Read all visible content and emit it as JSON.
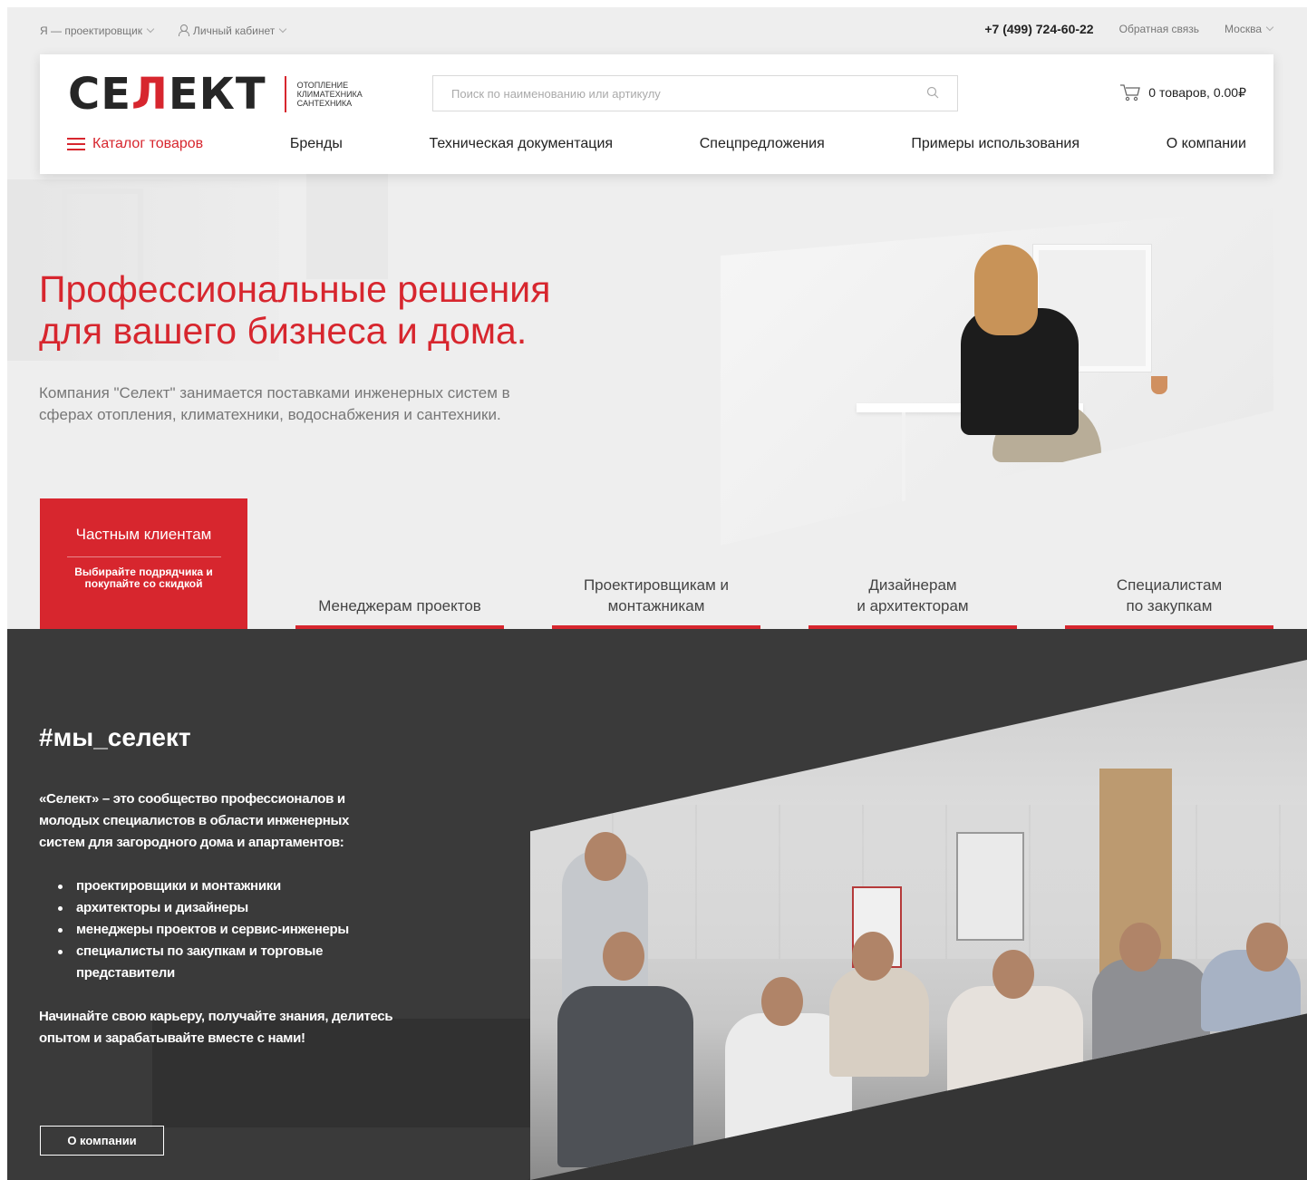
{
  "topbar": {
    "role_selector": "Я — проектировщик",
    "account": "Личный кабинет",
    "phone": "+7 (499) 724-60-22",
    "feedback": "Обратная связь",
    "city": "Москва"
  },
  "header": {
    "logo": {
      "word": "СЕЛЕКТ",
      "tagline": [
        "ОТОПЛЕНИЕ",
        "КЛИМАТЕХНИКА",
        "САНТЕХНИКА"
      ]
    },
    "search": {
      "placeholder": "Поиск по наименованию или артикулу",
      "value": ""
    },
    "cart": {
      "label": "0 товаров, 0.00₽"
    },
    "nav": [
      "Каталог товаров",
      "Бренды",
      "Техническая документация",
      "Спецпредложения",
      "Примеры использования",
      "О компании"
    ]
  },
  "hero": {
    "title_line1": "Профессиональные решения",
    "title_line2": "для вашего бизнеса и дома.",
    "description": "Компания \"Селект\" занимается поставками инженерных систем в сферах отопления, климатехники, водоснабжения и сантехники."
  },
  "audience_tabs": {
    "active": {
      "label": "Частным клиентам",
      "sublabel": "Выбирайте подрядчика и покупайте со скидкой"
    },
    "items": [
      {
        "line1": "Менеджерам проектов",
        "line2": ""
      },
      {
        "line1": "Проектировщикам и",
        "line2": "монтажникам"
      },
      {
        "line1": "Дизайнерам",
        "line2": "и архитекторам"
      },
      {
        "line1": "Специалистам",
        "line2": "по закупкам"
      }
    ]
  },
  "community": {
    "title": "#мы_селект",
    "intro": "«Селект» – это сообщество профессионалов и молодых специалистов в области инженерных систем для загородного дома и апартаментов:",
    "list": [
      "проектировщики и монтажники",
      "архитекторы и дизайнеры",
      "менеджеры проектов и сервис-инженеры",
      "специалисты по закупкам и торговые представители"
    ],
    "outro": "Начинайте свою карьеру, получайте знания, делитесь опытом и зарабатывайте вместе с нами!",
    "button": "О компании"
  },
  "colors": {
    "brand_red": "#d7262e",
    "dark_bg": "#3a3a3a",
    "light_bg": "#eeeeee"
  },
  "icons": [
    "user-icon",
    "chevron-down-icon",
    "search-icon",
    "cart-icon",
    "burger-icon"
  ]
}
